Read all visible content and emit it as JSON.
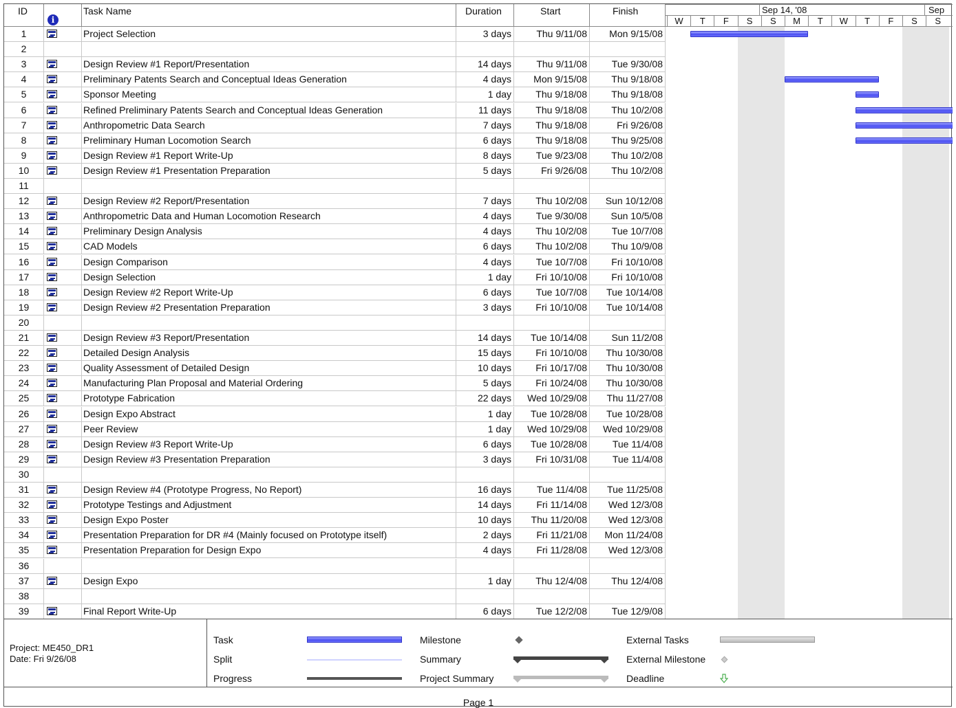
{
  "headers": {
    "id": "ID",
    "task_name": "Task Name",
    "duration": "Duration",
    "start": "Start",
    "finish": "Finish"
  },
  "timescale": {
    "week_labels": [
      "Sep 14, '08",
      "Sep"
    ],
    "days": [
      "W",
      "T",
      "F",
      "S",
      "S",
      "M",
      "T",
      "W",
      "T",
      "F",
      "S",
      "S"
    ]
  },
  "tasks": [
    {
      "id": "1",
      "icon": true,
      "name": "Project Selection",
      "duration": "3 days",
      "start": "Thu 9/11/08",
      "finish": "Mon 9/15/08",
      "bar": {
        "start": 1,
        "end": 6
      }
    },
    {
      "id": "2",
      "icon": false,
      "name": "",
      "duration": "",
      "start": "",
      "finish": ""
    },
    {
      "id": "3",
      "icon": true,
      "name": "Design Review #1 Report/Presentation",
      "duration": "14 days",
      "start": "Thu 9/11/08",
      "finish": "Tue 9/30/08"
    },
    {
      "id": "4",
      "icon": true,
      "name": "Preliminary Patents Search and Conceptual Ideas Generation",
      "duration": "4 days",
      "start": "Mon 9/15/08",
      "finish": "Thu 9/18/08",
      "bar": {
        "start": 5,
        "end": 9
      }
    },
    {
      "id": "5",
      "icon": true,
      "name": "Sponsor Meeting",
      "duration": "1 day",
      "start": "Thu 9/18/08",
      "finish": "Thu 9/18/08",
      "bar": {
        "start": 8,
        "end": 9
      }
    },
    {
      "id": "6",
      "icon": true,
      "name": "Refined Preliminary Patents Search and Conceptual Ideas Generation",
      "duration": "11 days",
      "start": "Thu 9/18/08",
      "finish": "Thu 10/2/08",
      "bar": {
        "start": 8,
        "end": 13
      }
    },
    {
      "id": "7",
      "icon": true,
      "name": "Anthropometric Data Search",
      "duration": "7 days",
      "start": "Thu 9/18/08",
      "finish": "Fri 9/26/08",
      "bar": {
        "start": 8,
        "end": 13
      }
    },
    {
      "id": "8",
      "icon": true,
      "name": "Preliminary Human Locomotion Search",
      "duration": "6 days",
      "start": "Thu 9/18/08",
      "finish": "Thu 9/25/08",
      "bar": {
        "start": 8,
        "end": 13
      }
    },
    {
      "id": "9",
      "icon": true,
      "name": "Design Review #1 Report Write-Up",
      "duration": "8 days",
      "start": "Tue 9/23/08",
      "finish": "Thu 10/2/08"
    },
    {
      "id": "10",
      "icon": true,
      "name": "Design Review #1 Presentation Preparation",
      "duration": "5 days",
      "start": "Fri 9/26/08",
      "finish": "Thu 10/2/08"
    },
    {
      "id": "11",
      "icon": false,
      "name": "",
      "duration": "",
      "start": "",
      "finish": ""
    },
    {
      "id": "12",
      "icon": true,
      "name": "Design Review #2 Report/Presentation",
      "duration": "7 days",
      "start": "Thu 10/2/08",
      "finish": "Sun 10/12/08"
    },
    {
      "id": "13",
      "icon": true,
      "name": "Anthropometric Data and Human Locomotion Research",
      "duration": "4 days",
      "start": "Tue 9/30/08",
      "finish": "Sun 10/5/08"
    },
    {
      "id": "14",
      "icon": true,
      "name": "Preliminary Design Analysis",
      "duration": "4 days",
      "start": "Thu 10/2/08",
      "finish": "Tue 10/7/08"
    },
    {
      "id": "15",
      "icon": true,
      "name": "CAD Models",
      "duration": "6 days",
      "start": "Thu 10/2/08",
      "finish": "Thu 10/9/08"
    },
    {
      "id": "16",
      "icon": true,
      "name": "Design Comparison",
      "duration": "4 days",
      "start": "Tue 10/7/08",
      "finish": "Fri 10/10/08"
    },
    {
      "id": "17",
      "icon": true,
      "name": "Design Selection",
      "duration": "1 day",
      "start": "Fri 10/10/08",
      "finish": "Fri 10/10/08"
    },
    {
      "id": "18",
      "icon": true,
      "name": "Design Review #2 Report Write-Up",
      "duration": "6 days",
      "start": "Tue 10/7/08",
      "finish": "Tue 10/14/08"
    },
    {
      "id": "19",
      "icon": true,
      "name": "Design Review #2 Presentation Preparation",
      "duration": "3 days",
      "start": "Fri 10/10/08",
      "finish": "Tue 10/14/08"
    },
    {
      "id": "20",
      "icon": false,
      "name": "",
      "duration": "",
      "start": "",
      "finish": ""
    },
    {
      "id": "21",
      "icon": true,
      "name": "Design Review #3 Report/Presentation",
      "duration": "14 days",
      "start": "Tue 10/14/08",
      "finish": "Sun 11/2/08"
    },
    {
      "id": "22",
      "icon": true,
      "name": "Detailed Design Analysis",
      "duration": "15 days",
      "start": "Fri 10/10/08",
      "finish": "Thu 10/30/08"
    },
    {
      "id": "23",
      "icon": true,
      "name": "Quality Assessment of Detailed Design",
      "duration": "10 days",
      "start": "Fri 10/17/08",
      "finish": "Thu 10/30/08"
    },
    {
      "id": "24",
      "icon": true,
      "name": "Manufacturing Plan Proposal and Material Ordering",
      "duration": "5 days",
      "start": "Fri 10/24/08",
      "finish": "Thu 10/30/08"
    },
    {
      "id": "25",
      "icon": true,
      "name": "Prototype Fabrication",
      "duration": "22 days",
      "start": "Wed 10/29/08",
      "finish": "Thu 11/27/08"
    },
    {
      "id": "26",
      "icon": true,
      "name": "Design Expo Abstract",
      "duration": "1 day",
      "start": "Tue 10/28/08",
      "finish": "Tue 10/28/08"
    },
    {
      "id": "27",
      "icon": true,
      "name": "Peer Review",
      "duration": "1 day",
      "start": "Wed 10/29/08",
      "finish": "Wed 10/29/08"
    },
    {
      "id": "28",
      "icon": true,
      "name": "Design Review #3 Report Write-Up",
      "duration": "6 days",
      "start": "Tue 10/28/08",
      "finish": "Tue 11/4/08"
    },
    {
      "id": "29",
      "icon": true,
      "name": "Design Review #3 Presentation Preparation",
      "duration": "3 days",
      "start": "Fri 10/31/08",
      "finish": "Tue 11/4/08"
    },
    {
      "id": "30",
      "icon": false,
      "name": "",
      "duration": "",
      "start": "",
      "finish": ""
    },
    {
      "id": "31",
      "icon": true,
      "name": "Design Review #4 (Prototype Progress, No Report)",
      "duration": "16 days",
      "start": "Tue 11/4/08",
      "finish": "Tue 11/25/08"
    },
    {
      "id": "32",
      "icon": true,
      "name": "Prototype Testings and Adjustment",
      "duration": "14 days",
      "start": "Fri 11/14/08",
      "finish": "Wed 12/3/08"
    },
    {
      "id": "33",
      "icon": true,
      "name": "Design Expo Poster",
      "duration": "10 days",
      "start": "Thu 11/20/08",
      "finish": "Wed 12/3/08"
    },
    {
      "id": "34",
      "icon": true,
      "name": "Presentation Preparation for DR #4 (Mainly focused on Prototype itself)",
      "duration": "2 days",
      "start": "Fri 11/21/08",
      "finish": "Mon 11/24/08"
    },
    {
      "id": "35",
      "icon": true,
      "name": "Presentation Preparation for Design Expo",
      "duration": "4 days",
      "start": "Fri 11/28/08",
      "finish": "Wed 12/3/08"
    },
    {
      "id": "36",
      "icon": false,
      "name": "",
      "duration": "",
      "start": "",
      "finish": ""
    },
    {
      "id": "37",
      "icon": true,
      "name": "Design Expo",
      "duration": "1 day",
      "start": "Thu 12/4/08",
      "finish": "Thu 12/4/08"
    },
    {
      "id": "38",
      "icon": false,
      "name": "",
      "duration": "",
      "start": "",
      "finish": ""
    },
    {
      "id": "39",
      "icon": true,
      "name": "Final Report Write-Up",
      "duration": "6 days",
      "start": "Tue 12/2/08",
      "finish": "Tue 12/9/08"
    }
  ],
  "legend": {
    "project": "Project: ME450_DR1",
    "date": "Date: Fri 9/26/08",
    "items": [
      "Task",
      "Split",
      "Progress",
      "Milestone",
      "Summary",
      "Project Summary",
      "External Tasks",
      "External Milestone",
      "Deadline"
    ]
  },
  "footer": {
    "page": "Page 1"
  },
  "colors": {
    "task_bar": "#4a4ff0",
    "weekend_shade": "#e6e6e6",
    "info_icon": "#1f2bb8"
  }
}
